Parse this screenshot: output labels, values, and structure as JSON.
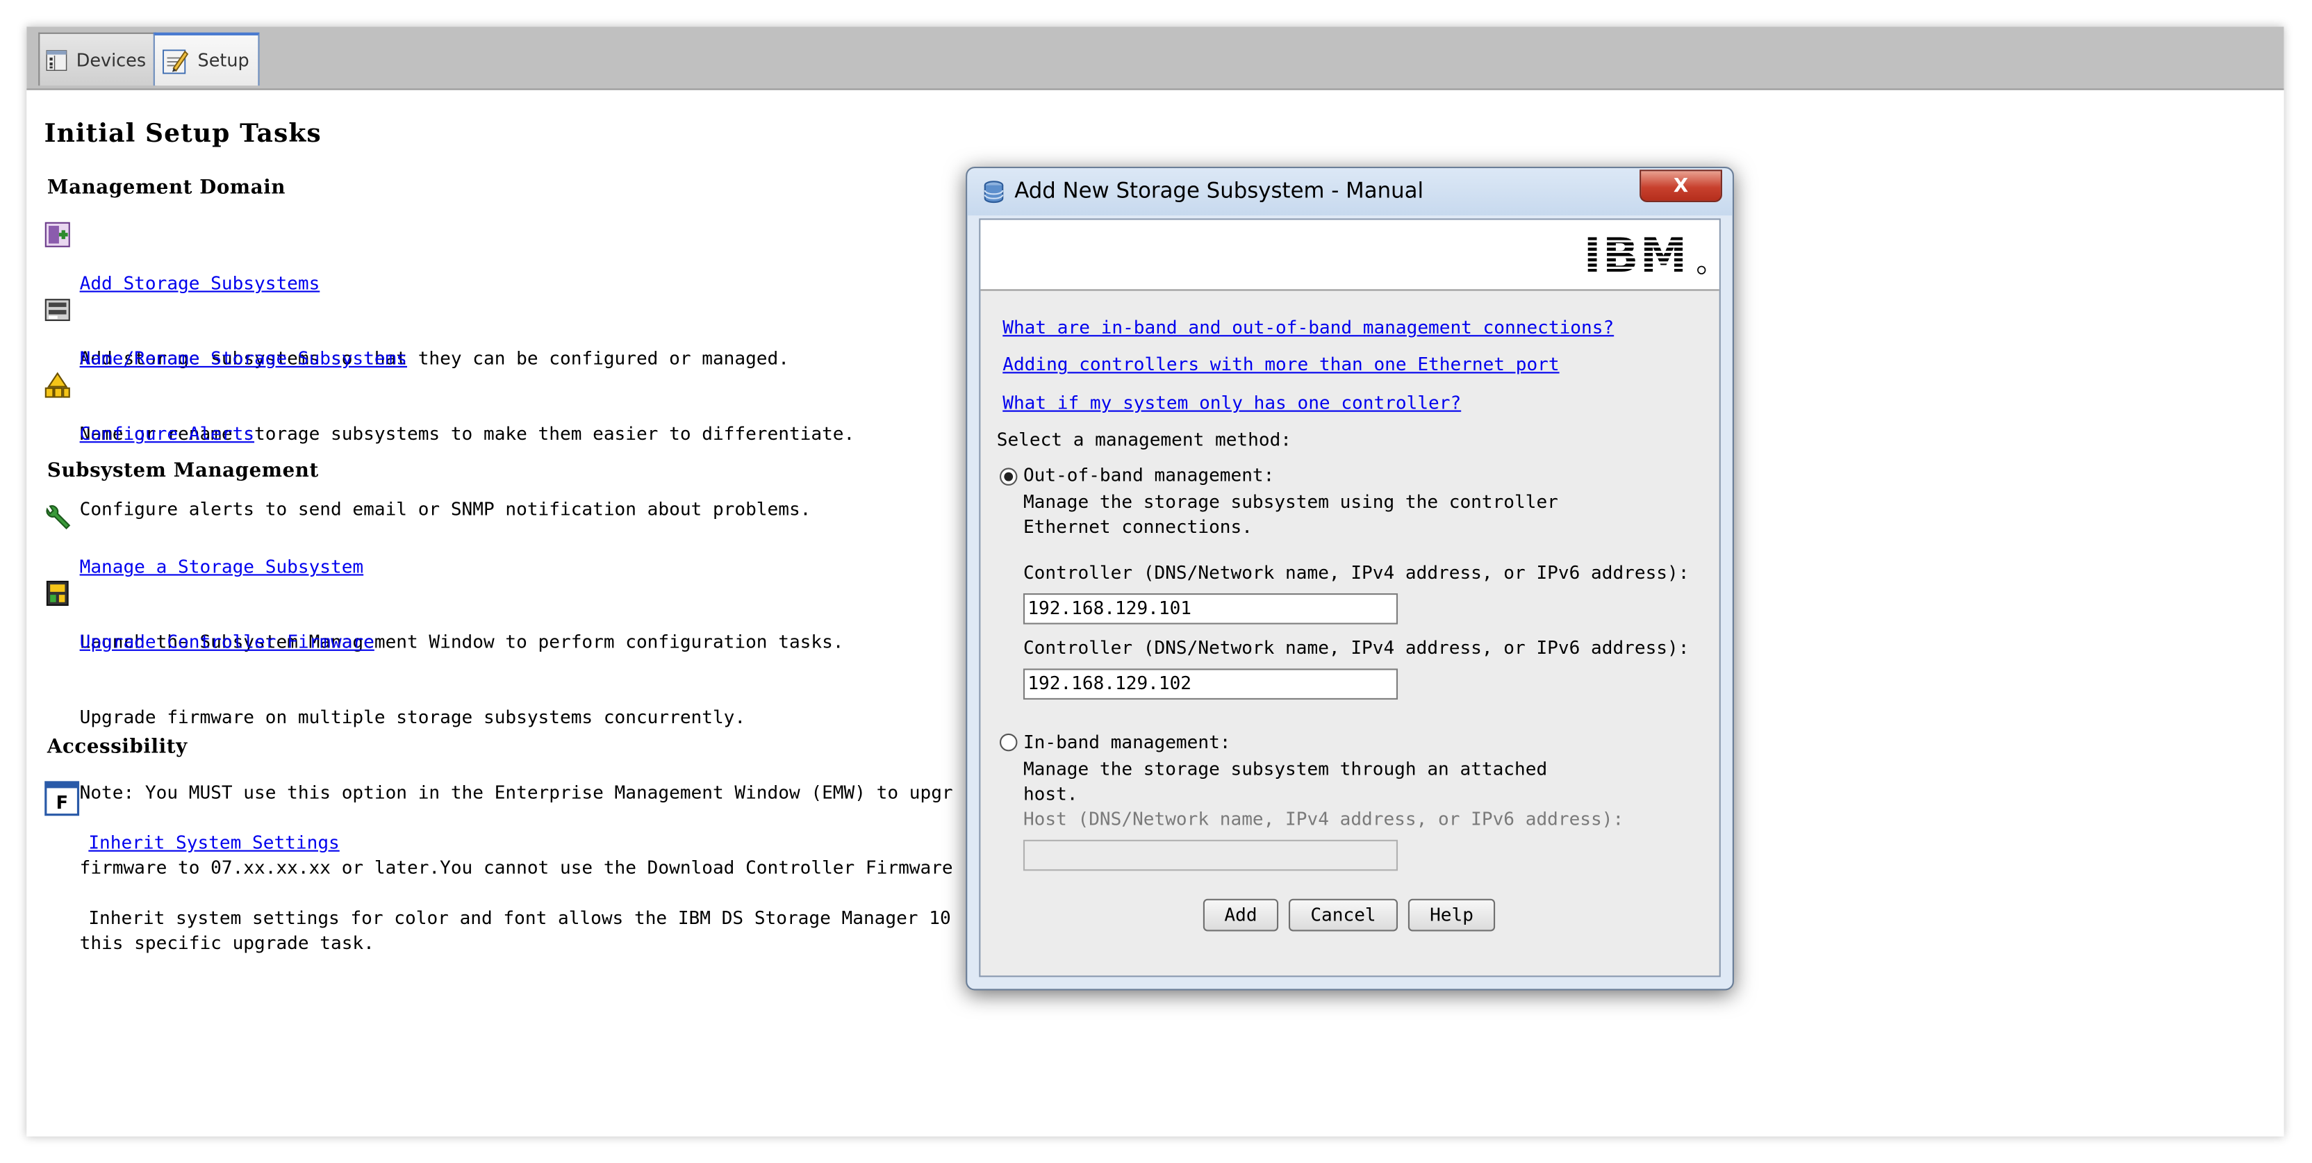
{
  "tabs": [
    {
      "label": "Devices",
      "active": false
    },
    {
      "label": "Setup",
      "active": true
    }
  ],
  "page": {
    "title": "Initial Setup Tasks",
    "sections": {
      "management_domain": "Management Domain",
      "subsystem_management": "Subsystem Management",
      "accessibility": "Accessibility"
    },
    "tasks": [
      {
        "link": "Add Storage Subsystems",
        "desc": [
          "Add storage subsystems so that they can be configured or managed."
        ],
        "icon": "add-storage-icon"
      },
      {
        "link": "Name/Rename Storage Subsystems",
        "desc": [
          "Name or rename storage subsystems to make them easier to differentiate."
        ],
        "icon": "rename-storage-icon"
      },
      {
        "link": "Configure Alerts",
        "desc": [
          "Configure alerts to send email or SNMP notification about problems."
        ],
        "icon": "alerts-icon"
      },
      {
        "link": "Manage a Storage Subsystem",
        "desc": [
          "Launch the Subsystem Management Window to perform configuration tasks."
        ],
        "icon": "wrench-icon"
      },
      {
        "link": "Upgrade Controller Firmware",
        "desc": [
          "Upgrade firmware on multiple storage subsystems concurrently.",
          "Note: You MUST use this option in the Enterprise Management Window (EMW) to upgr",
          "firmware to 07.xx.xx.xx or later.You cannot use the Download Controller Firmware",
          "this specific upgrade task."
        ],
        "icon": "firmware-icon"
      },
      {
        "link": "Inherit System Settings",
        "desc": [
          "Inherit system settings for color and font allows the IBM DS Storage Manager 10"
        ],
        "icon": "inherit-settings-icon"
      }
    ]
  },
  "dialog": {
    "title": "Add New Storage Subsystem - Manual",
    "close_label": "X",
    "brand": "IBM",
    "links": [
      "What are in-band and out-of-band management connections?",
      "Adding controllers with more than one Ethernet port",
      "What if my system only has one controller?"
    ],
    "select_method": "Select a management method:",
    "out_of_band": {
      "label": "Out-of-band management:",
      "selected": true,
      "desc": [
        "Manage the storage subsystem using the controller",
        "Ethernet connections."
      ],
      "controller_label": "Controller (DNS/Network name, IPv4 address, or IPv6 address):",
      "controller1_value": "192.168.129.101",
      "controller2_value": "192.168.129.102"
    },
    "in_band": {
      "label": "In-band management:",
      "selected": false,
      "desc": [
        "Manage the storage subsystem through an attached",
        "host."
      ],
      "host_label": "Host (DNS/Network name, IPv4 address, or IPv6 address):",
      "host_value": ""
    },
    "buttons": {
      "add": "Add",
      "cancel": "Cancel",
      "help": "Help"
    }
  }
}
